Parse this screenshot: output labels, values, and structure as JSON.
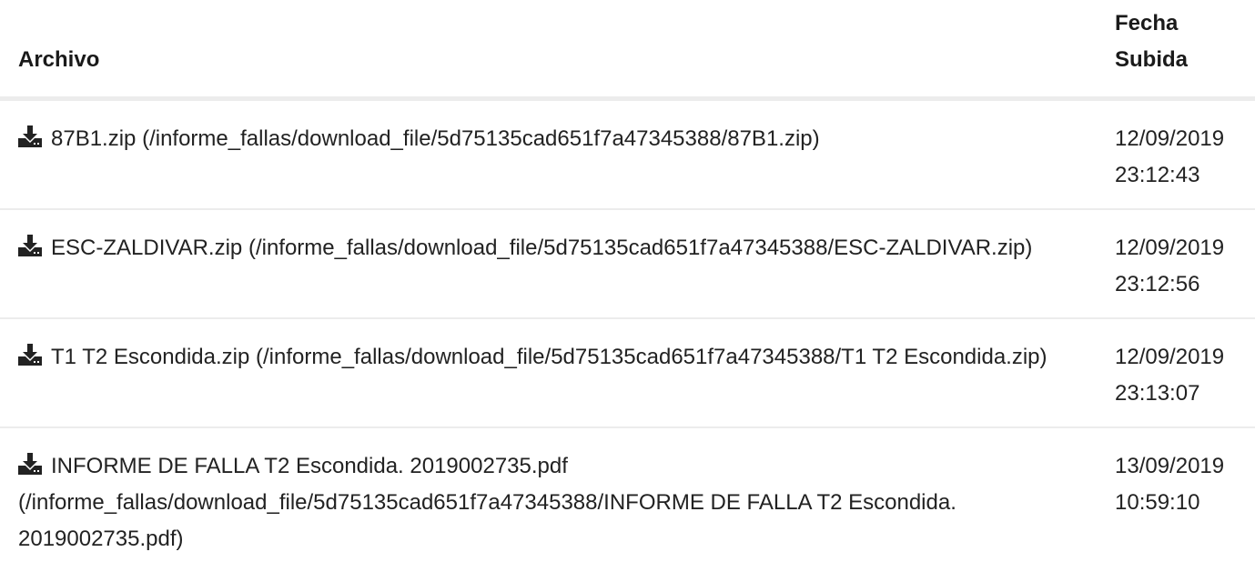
{
  "table": {
    "headers": {
      "file": "Archivo",
      "date_line1": "Fecha",
      "date_line2": "Subida"
    },
    "rows": [
      {
        "icon": "download-icon",
        "name": "87B1.zip",
        "path": "(/informe_fallas/download_file/5d75135cad651f7a47345388/87B1.zip)",
        "date": "12/09/2019",
        "time": "23:12:43"
      },
      {
        "icon": "download-icon",
        "name": "ESC-ZALDIVAR.zip",
        "path": "(/informe_fallas/download_file/5d75135cad651f7a47345388/ESC-ZALDIVAR.zip)",
        "date": "12/09/2019",
        "time": "23:12:56"
      },
      {
        "icon": "download-icon",
        "name": "T1 T2 Escondida.zip",
        "path": "(/informe_fallas/download_file/5d75135cad651f7a47345388/T1 T2 Escondida.zip)",
        "date": "12/09/2019",
        "time": "23:13:07"
      },
      {
        "icon": "download-icon",
        "name": "INFORME DE FALLA T2 Escondida. 2019002735.pdf",
        "path": "(/informe_fallas/download_file/5d75135cad651f7a47345388/INFORME DE FALLA T2 Escondida. 2019002735.pdf)",
        "date": "13/09/2019",
        "time": "10:59:10"
      }
    ]
  }
}
